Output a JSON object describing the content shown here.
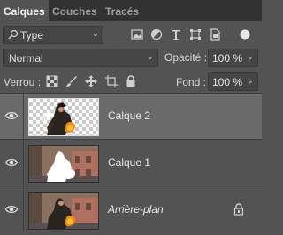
{
  "tabs": [
    {
      "label": "Calques"
    },
    {
      "label": "Couches"
    },
    {
      "label": "Tracés"
    }
  ],
  "filter": {
    "kind_label": "Type",
    "icons": [
      "pixel-filter-icon",
      "adjustment-filter-icon",
      "text-filter-icon",
      "shape-filter-icon",
      "smart-object-filter-icon"
    ]
  },
  "blend": {
    "mode": "Normal",
    "opacity_label": "Opacité :",
    "opacity_value": "100 %"
  },
  "lock": {
    "label": "Verrou :",
    "icons": [
      "lock-transparent-pixels-icon",
      "lock-image-pixels-icon",
      "lock-position-icon",
      "lock-artboard-icon",
      "lock-all-icon"
    ],
    "fill_label": "Fond :",
    "fill_value": "100 %"
  },
  "layers": [
    {
      "name": "Calque 2",
      "selected": true,
      "visible": true,
      "locked": false
    },
    {
      "name": "Calque 1",
      "selected": false,
      "visible": true,
      "locked": false
    },
    {
      "name": "Arrière-plan",
      "selected": false,
      "visible": true,
      "locked": true,
      "italic": true
    }
  ],
  "colors": {
    "panel": "#535353",
    "selected_layer": "#6a6a6a",
    "tab_bar": "#323232"
  }
}
